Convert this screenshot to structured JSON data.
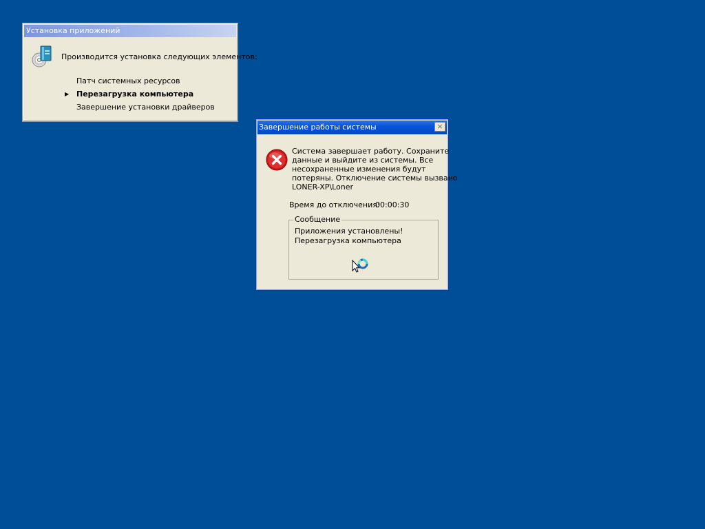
{
  "install_window": {
    "title": "Установка приложений",
    "heading": "Производится установка следующих элементов:",
    "items": [
      {
        "label": "Патч системных ресурсов",
        "current": false
      },
      {
        "label": "Перезагрузка компьютера",
        "current": true
      },
      {
        "label": "Завершение установки драйверов",
        "current": false
      }
    ],
    "icon": "install-cd-icon"
  },
  "shutdown_window": {
    "title": "Завершение работы системы",
    "close_symbol": "×",
    "icon": "error-icon",
    "message_lines": [
      "Система завершает работу.  Сохраните",
      "данные и выйдите из системы.  Все",
      "несохраненные изменения будут",
      "потеряны.  Отключение системы вызвано",
      "LONER-XP\\Loner"
    ],
    "time_label": "Время до отключения:",
    "time_value": "00:00:30",
    "group_label": "Сообщение",
    "group_lines": [
      "Приложения установлены!",
      "Перезагрузка компьютера"
    ]
  },
  "cursor": "busy-cursor-icon",
  "colors": {
    "desktop": "#004e98",
    "window_face": "#ece9d8",
    "active_title": "#0a56d8",
    "inactive_title": "#7a96df",
    "error_red": "#d41f1f"
  }
}
